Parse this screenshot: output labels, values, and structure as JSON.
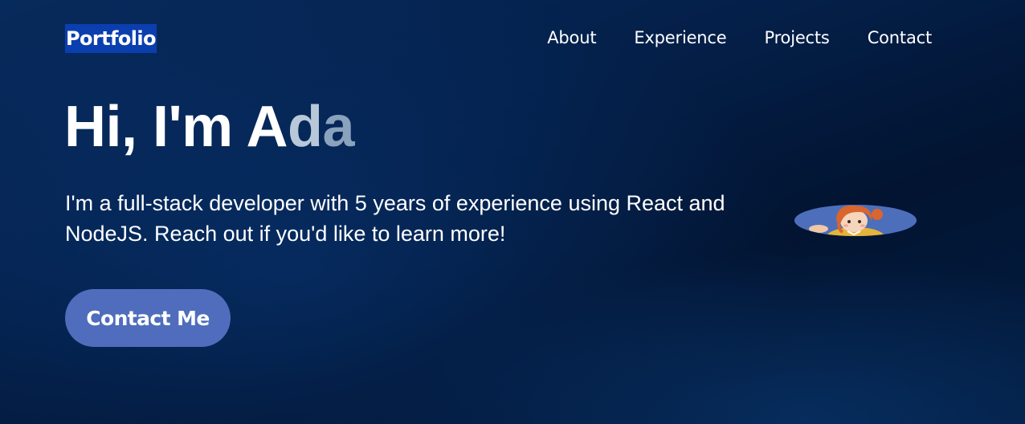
{
  "navbar": {
    "brand": "Portfolio",
    "links": [
      {
        "label": "About"
      },
      {
        "label": "Experience"
      },
      {
        "label": "Projects"
      },
      {
        "label": "Contact"
      }
    ]
  },
  "hero": {
    "title_main": "Hi, I'm A",
    "title_fade_1": "d",
    "title_fade_2": "a",
    "description": "I'm a full-stack developer with 5 years of experience using React and NodeJS. Reach out if you'd like to learn more!",
    "cta_label": "Contact Me",
    "avatar_icon": "avatar-illustration"
  },
  "colors": {
    "background_top": "#072a5c",
    "background_dark": "#021431",
    "brand_highlight": "#0b3fb0",
    "button": "#4f6dbc",
    "text": "#ffffff"
  }
}
